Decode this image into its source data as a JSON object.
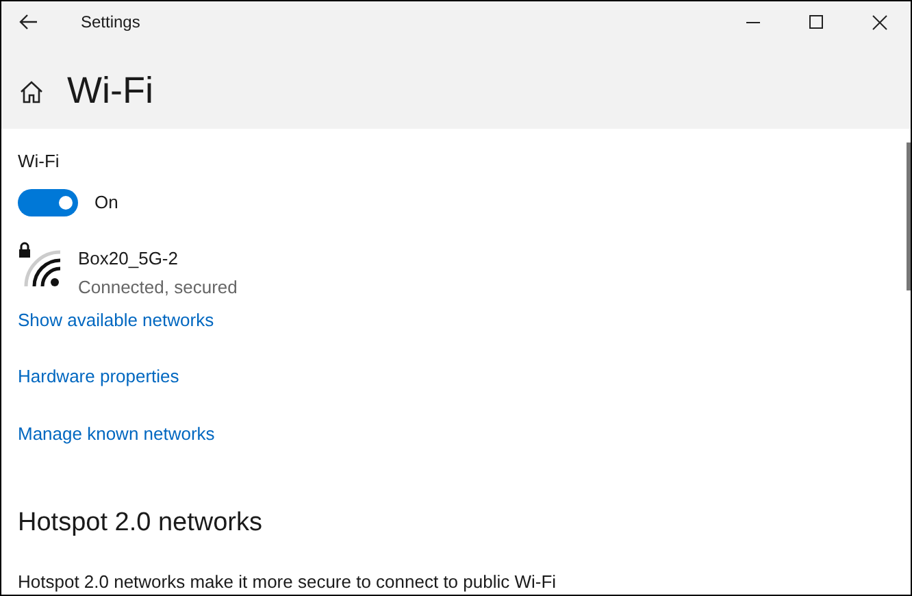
{
  "window": {
    "title": "Settings"
  },
  "page_title": "Wi-Fi",
  "wifi_toggle": {
    "label": "Wi-Fi",
    "on": true,
    "state_text": "On"
  },
  "network": {
    "name": "Box20_5G-2",
    "status": "Connected, secured"
  },
  "links": [
    "Show available networks",
    "Hardware properties",
    "Manage known networks"
  ],
  "hotspot": {
    "heading": "Hotspot 2.0 networks",
    "description": "Hotspot 2.0 networks make it more secure to connect to public Wi-Fi"
  }
}
